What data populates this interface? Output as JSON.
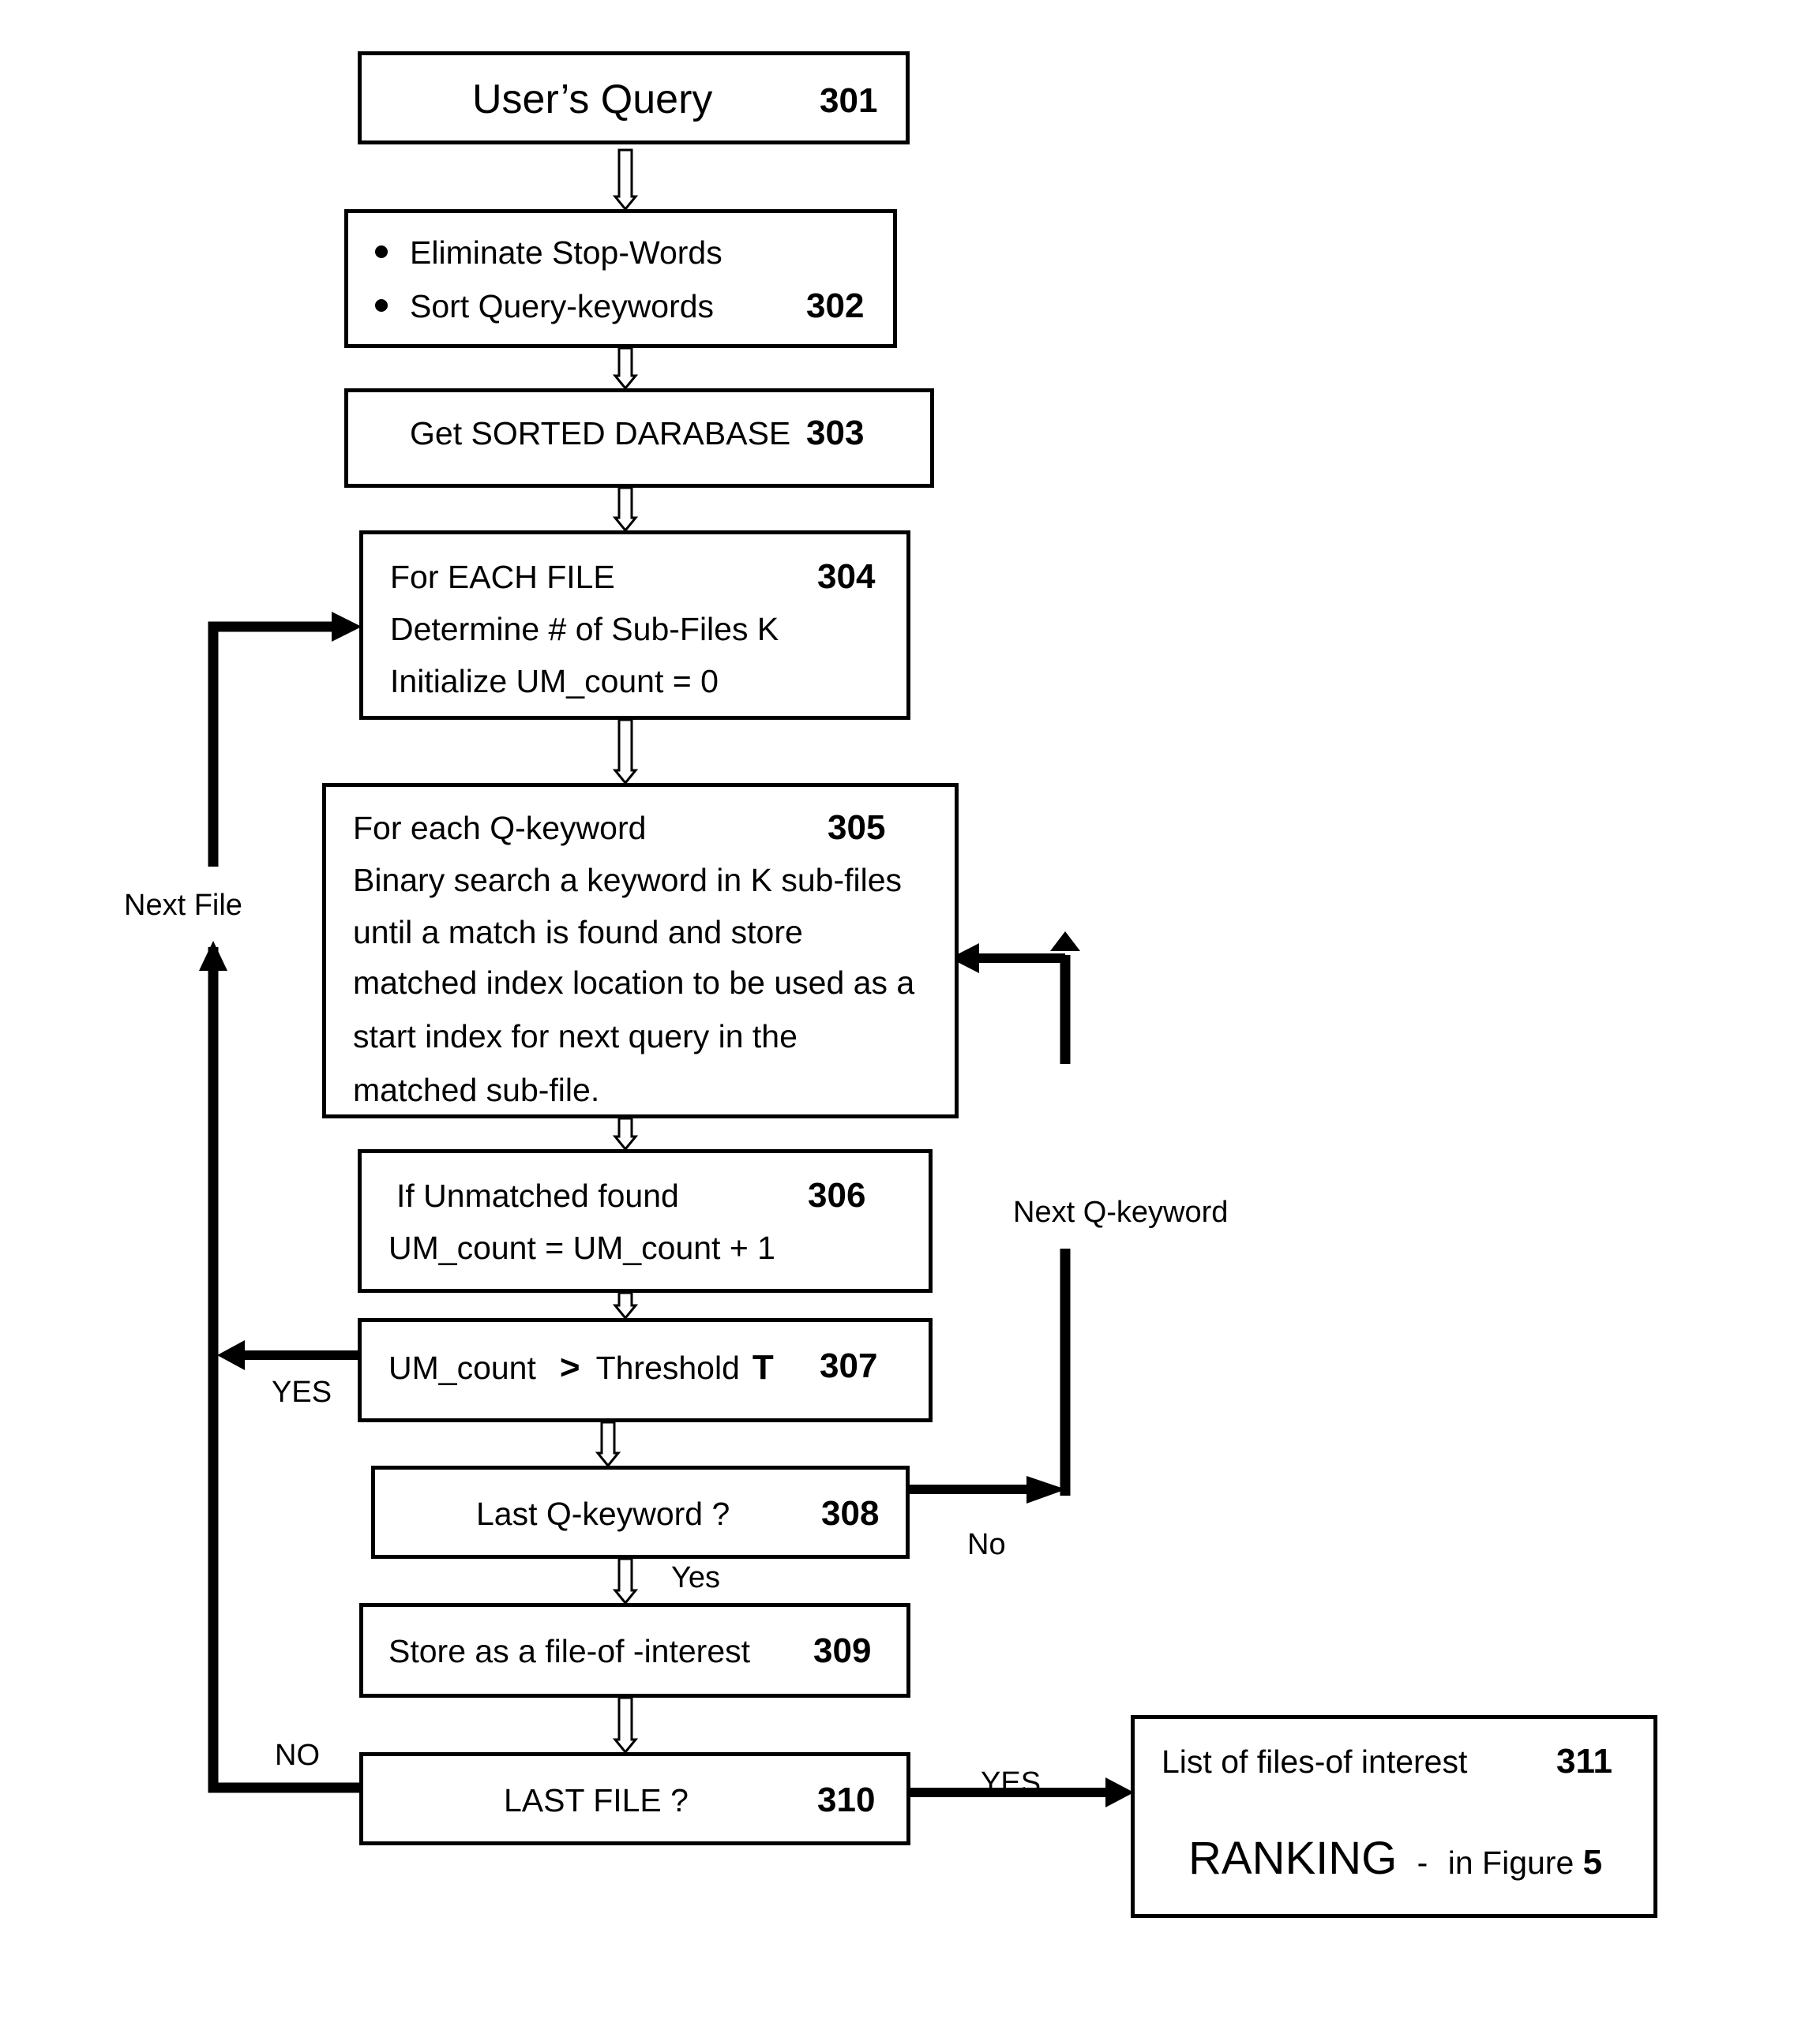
{
  "figure": {
    "steps": {
      "s301": {
        "text": "User’s Query",
        "number": "301"
      },
      "s302": {
        "bullets": [
          "Eliminate Stop-Words",
          "Sort Query-keywords"
        ],
        "number": "302"
      },
      "s303": {
        "text": "Get SORTED DARABASE",
        "number": "303"
      },
      "s304": {
        "lines": [
          "For EACH FILE",
          "Determine # of Sub-Files K",
          "Initialize UM_count = 0"
        ],
        "number": "304"
      },
      "s305": {
        "lines": [
          "For each Q-keyword",
          "Binary search a keyword in K sub-files",
          "until a match is found and store",
          "matched index location to be used as a",
          "start index for next query in the",
          "matched sub-file."
        ],
        "number": "305"
      },
      "s306": {
        "lines": [
          "If Unmatched found",
          "UM_count = UM_count + 1"
        ],
        "number": "306"
      },
      "s307": {
        "text_pre": "UM_count",
        "operator": ">",
        "text_mid": "Threshold",
        "var": "T",
        "number": "307"
      },
      "s308": {
        "text": "Last Q-keyword ?",
        "number": "308"
      },
      "s309": {
        "text": "Store as a file-of -interest",
        "number": "309"
      },
      "s310": {
        "text": "LAST FILE ?",
        "number": "310"
      },
      "s311": {
        "line1": "List of files-of interest",
        "number": "311",
        "ranking": "RANKING",
        "dash": "-",
        "in_figure": "in Figure",
        "figure_num": "5"
      }
    },
    "edge_labels": {
      "next_file": "Next File",
      "yes_307": "YES",
      "no_310": "NO",
      "next_q_keyword": "Next Q-keyword",
      "no_308": "No",
      "yes_308": "Yes",
      "yes_310": "YES"
    }
  }
}
